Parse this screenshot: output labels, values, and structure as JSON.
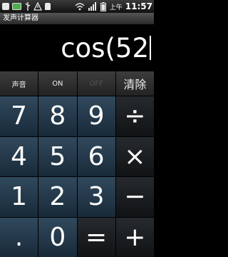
{
  "status_bar": {
    "icons": [
      "app-notification-icon",
      "battery-saver-icon",
      "usb-icon",
      "warning-icon",
      "sd-card-icon",
      "wifi-icon",
      "cell-signal-icon",
      "battery-icon"
    ],
    "lang": "上午",
    "time": "11:57"
  },
  "app": {
    "title": "发声计算器"
  },
  "display": {
    "expression": "cos(52"
  },
  "function_row": {
    "sound": "声音",
    "on": "ON",
    "off": "OFF",
    "clear": "清除"
  },
  "keys": {
    "k7": "7",
    "k8": "8",
    "k9": "9",
    "divide": "÷",
    "k4": "4",
    "k5": "5",
    "k6": "6",
    "multiply": "×",
    "k1": "1",
    "k2": "2",
    "k3": "3",
    "minus": "−",
    "dot": ".",
    "k0": "0",
    "equals": "=",
    "plus": "+"
  }
}
